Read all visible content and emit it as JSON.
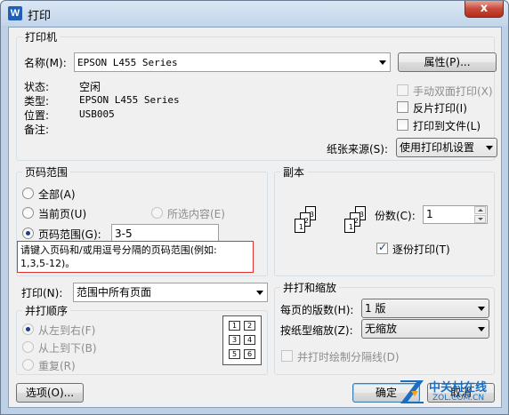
{
  "window": {
    "title": "打印",
    "close_glyph": "x",
    "app_icon_letter": "W"
  },
  "printer": {
    "group_label": "打印机",
    "name_label": "名称(M):",
    "name_value": "EPSON L455 Series",
    "properties_button": "属性(P)...",
    "status_label": "状态:",
    "status_value": "空闲",
    "type_label": "类型:",
    "type_value": "EPSON L455 Series",
    "location_label": "位置:",
    "location_value": "USB005",
    "comment_label": "备注:",
    "manual_duplex": "手动双面打印(X)",
    "reverse_print": "反片打印(I)",
    "print_to_file": "打印到文件(L)",
    "paper_source_label": "纸张来源(S):",
    "paper_source_value": "使用打印机设置"
  },
  "page_range": {
    "group_label": "页码范围",
    "all": "全部(A)",
    "current": "当前页(U)",
    "selection": "所选内容(E)",
    "range": "页码范围(G):",
    "range_value": "3-5",
    "hint_line1": "请键入页码和/或用逗号分隔的页码范围(例如:",
    "hint_line2": "1,3,5-12)。"
  },
  "copies": {
    "group_label": "副本",
    "count_label": "份数(C):",
    "count_value": "1",
    "collate": "逐份打印(T)",
    "stack_pages": [
      "1",
      "2",
      "3"
    ]
  },
  "print_what": {
    "label": "打印(N):",
    "value": "范围中所有页面"
  },
  "order": {
    "group_label": "并打顺序",
    "left_to_right": "从左到右(F)",
    "top_to_bottom": "从上到下(B)",
    "repeat": "重复(R)",
    "preview_cells": [
      "1",
      "2",
      "3",
      "4",
      "5",
      "6"
    ]
  },
  "zoom": {
    "group_label": "并打和缩放",
    "pages_per_sheet_label": "每页的版数(H):",
    "pages_per_sheet_value": "1 版",
    "scale_label": "按纸型缩放(Z):",
    "scale_value": "无缩放",
    "draw_lines": "并打时绘制分隔线(D)"
  },
  "buttons": {
    "options": "选项(O)...",
    "ok": "确定",
    "cancel": "取消"
  },
  "watermark": {
    "brand": "中关村在线",
    "domain": "ZOL.COM.CN"
  },
  "colors": {
    "hint_border": "#e03030",
    "check_mark": "#1e3f8a",
    "watermark_blue": "#1a6ec3"
  }
}
